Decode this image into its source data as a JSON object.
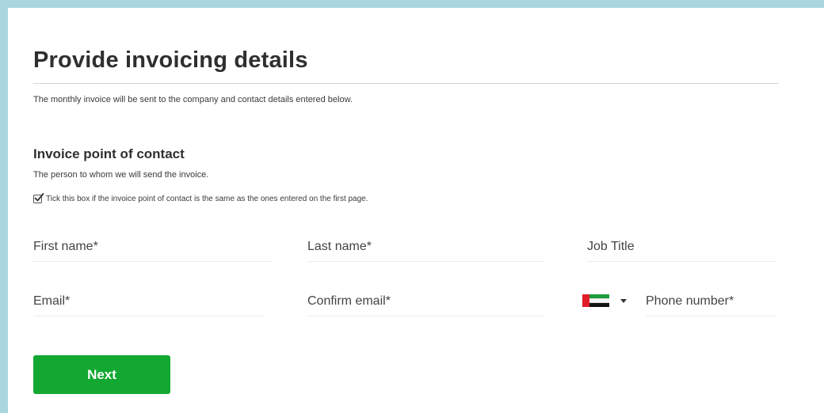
{
  "page": {
    "title": "Provide invoicing details",
    "subtitle": "The monthly invoice will be sent to the company and contact details entered below."
  },
  "section": {
    "title": "Invoice point of contact",
    "description": "The person to whom we will send the invoice.",
    "same_contact_checkbox": {
      "label": "Tick this box if the invoice point of contact is the same as the ones entered on the first page.",
      "checked": true
    }
  },
  "fields": {
    "first_name": {
      "placeholder": "First name*",
      "value": ""
    },
    "last_name": {
      "placeholder": "Last name*",
      "value": ""
    },
    "job_title": {
      "placeholder": "Job Title",
      "value": ""
    },
    "email": {
      "placeholder": "Email*",
      "value": ""
    },
    "confirm_email": {
      "placeholder": "Confirm email*",
      "value": ""
    },
    "phone": {
      "placeholder": "Phone number*",
      "value": "",
      "country_flag_icon": "uae-flag-icon"
    }
  },
  "actions": {
    "next_label": "Next"
  },
  "colors": {
    "frame_border": "#a9d6df",
    "primary_button": "#13a832",
    "text": "#333333"
  }
}
